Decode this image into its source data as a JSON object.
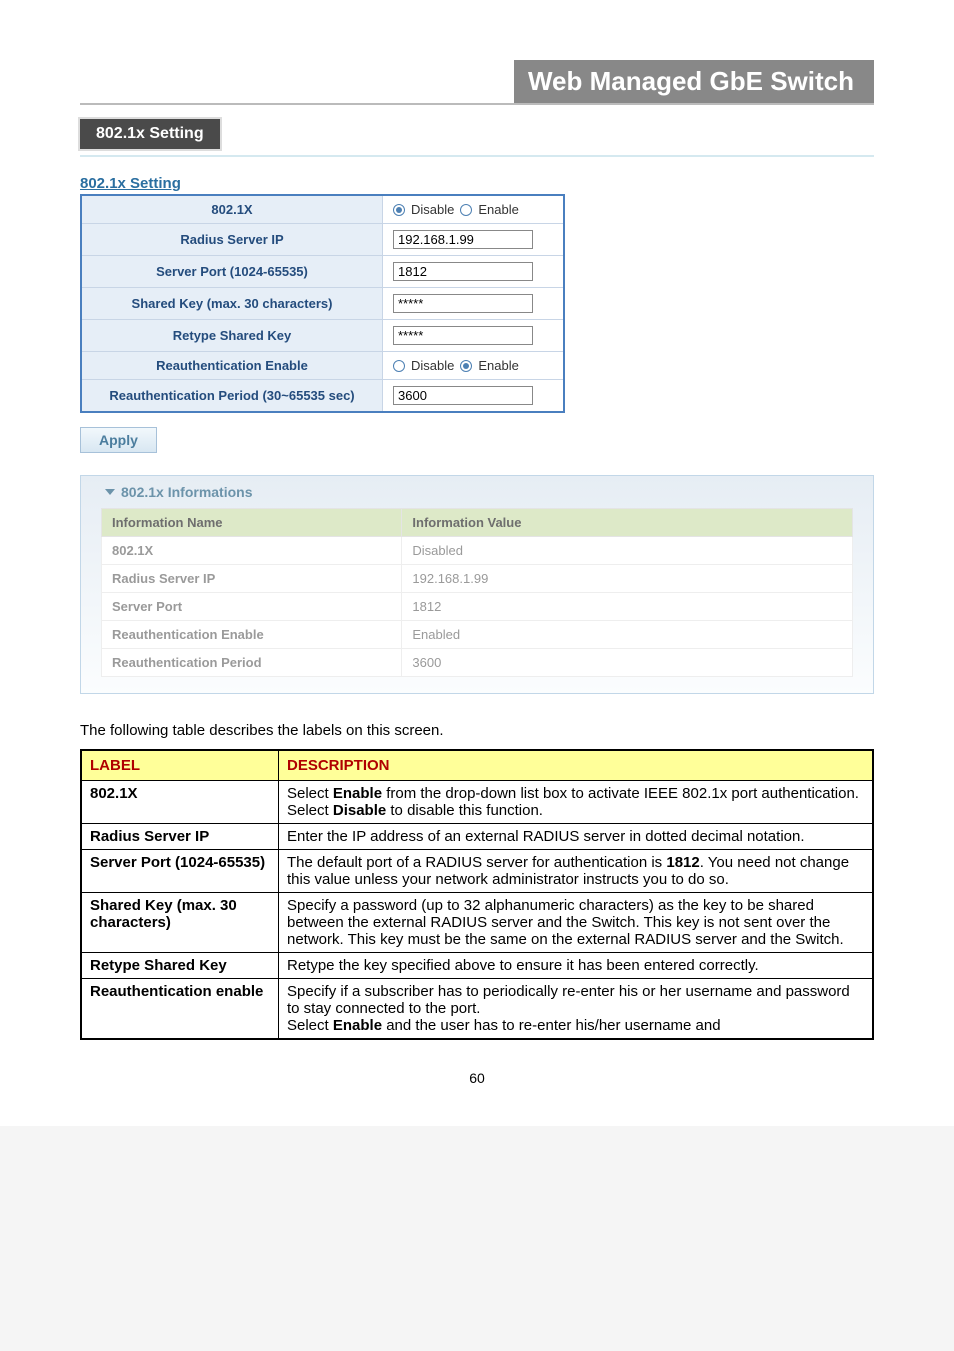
{
  "header": {
    "title": "Web Managed GbE Switch"
  },
  "section": {
    "title": "802.1x Setting",
    "subhead": "802.1x Setting"
  },
  "settings": {
    "rows": [
      {
        "label": "802.1X",
        "type": "radio",
        "disable": "Disable",
        "enable": "Enable",
        "checked": "disable"
      },
      {
        "label": "Radius Server IP",
        "type": "text",
        "value": "192.168.1.99"
      },
      {
        "label": "Server Port (1024-65535)",
        "type": "text",
        "value": "1812"
      },
      {
        "label": "Shared Key (max. 30 characters)",
        "type": "password",
        "value": "*****"
      },
      {
        "label": "Retype Shared Key",
        "type": "password",
        "value": "*****"
      },
      {
        "label": "Reauthentication Enable",
        "type": "radio",
        "disable": "Disable",
        "enable": "Enable",
        "checked": "enable"
      },
      {
        "label": "Reauthentication Period (30~65535 sec)",
        "type": "text",
        "value": "3600"
      }
    ]
  },
  "apply": {
    "label": "Apply"
  },
  "info_panel": {
    "title": "802.1x Informations",
    "head_name": "Information Name",
    "head_value": "Information Value",
    "rows": [
      {
        "name": "802.1X",
        "value": "Disabled"
      },
      {
        "name": "Radius Server IP",
        "value": "192.168.1.99"
      },
      {
        "name": "Server Port",
        "value": "1812"
      },
      {
        "name": "Reauthentication Enable",
        "value": "Enabled"
      },
      {
        "name": "Reauthentication Period",
        "value": "3600"
      }
    ]
  },
  "intro": "The following table describes the labels on this screen.",
  "desc_table": {
    "head_label": "LABEL",
    "head_desc": "DESCRIPTION",
    "rows": [
      {
        "label": "802.1X",
        "desc_parts": [
          "Select ",
          "Enable",
          " from the drop-down list box to activate IEEE 802.1x port authentication.\nSelect ",
          "Disable",
          " to disable this function."
        ]
      },
      {
        "label": "Radius Server IP",
        "desc_parts": [
          "Enter the IP address of an external RADIUS server in dotted decimal notation."
        ]
      },
      {
        "label": "Server Port (1024-65535)",
        "desc_parts": [
          "The default port of a RADIUS server for authentication is ",
          "1812",
          ". You need not change this value unless your network administrator instructs you to do so."
        ]
      },
      {
        "label": "Shared Key (max. 30 characters)",
        "desc_parts": [
          "Specify a password (up to 32 alphanumeric characters) as the key to be shared between the external RADIUS server and the Switch. This key is not sent over the network. This key must be the same on the external RADIUS server and the Switch."
        ]
      },
      {
        "label": "Retype Shared Key",
        "desc_parts": [
          "Retype the key specified above to ensure it has been entered correctly."
        ]
      },
      {
        "label": "Reauthentication enable",
        "desc_parts": [
          "Specify if a subscriber has to periodically re-enter his or her username and password to stay connected to the port.\nSelect ",
          "Enable",
          " and the user has to re-enter his/her username and"
        ]
      }
    ]
  },
  "page_number": "60"
}
